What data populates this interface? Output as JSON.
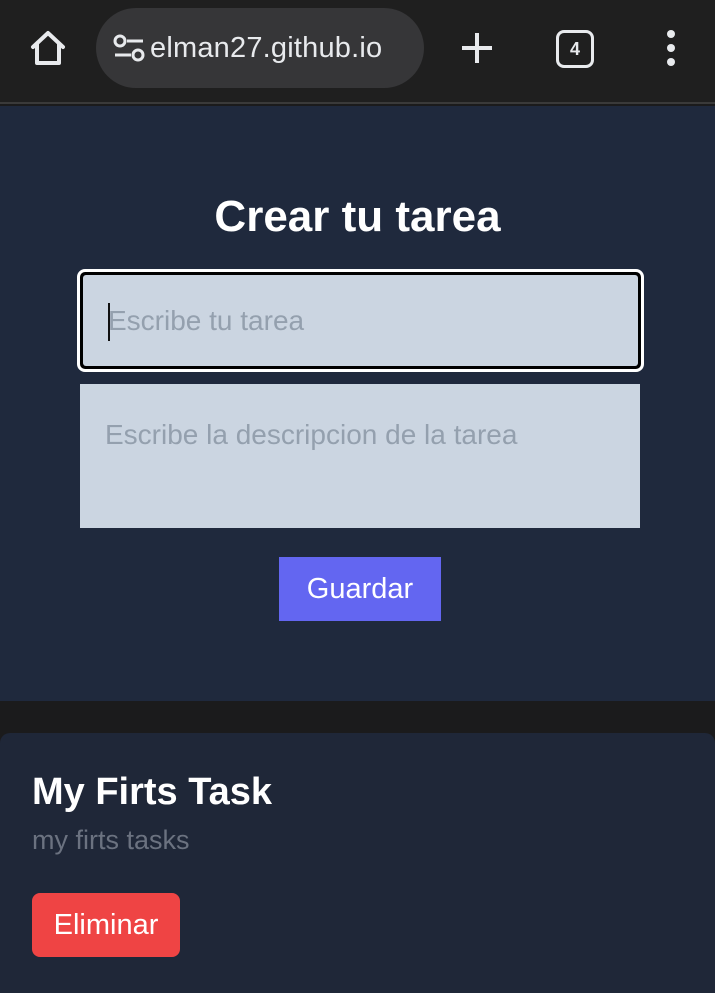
{
  "browser": {
    "url": "elman27.github.io",
    "tab_count": "4",
    "icons": {
      "home": "home-icon",
      "site_settings": "tune-icon",
      "new_tab": "plus-icon",
      "tabs": "tab-switcher-icon",
      "menu": "more-vert-icon"
    }
  },
  "form": {
    "title": "Crear tu tarea",
    "task_placeholder": "Escribe tu tarea",
    "task_value": "",
    "description_placeholder": "Escribe la descripcion de la tarea",
    "description_value": "",
    "save_label": "Guardar"
  },
  "tasks": [
    {
      "title": "My Firts Task",
      "description": "my firts tasks",
      "delete_label": "Eliminar"
    }
  ],
  "colors": {
    "page_bg": "#1b1b1c",
    "form_bg": "#1f293d",
    "card_bg": "#1f2738",
    "input_bg": "#cbd5e1",
    "save_button": "#6366f1",
    "delete_button": "#ef4444"
  }
}
